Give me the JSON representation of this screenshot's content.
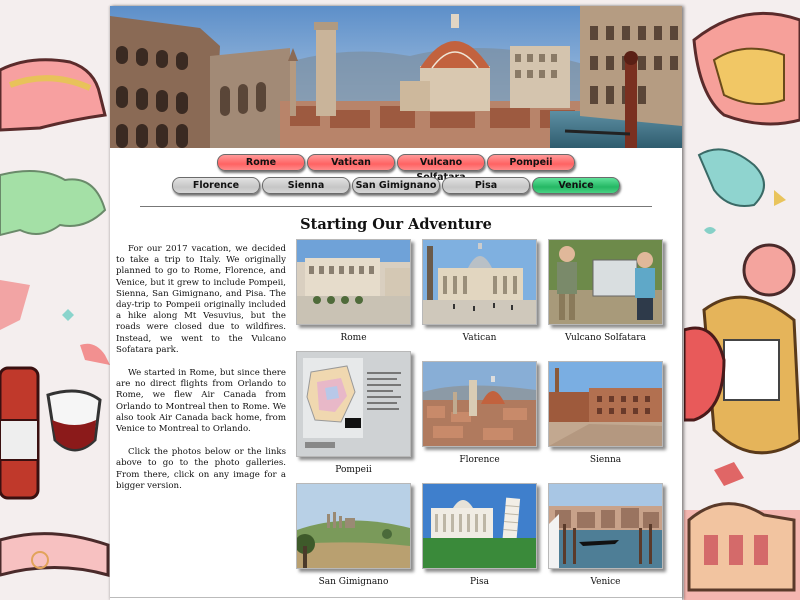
{
  "nav": {
    "row1": [
      {
        "label": "Rome",
        "color": "red"
      },
      {
        "label": "Vatican",
        "color": "red"
      },
      {
        "label": "Vulcano Solfatara",
        "color": "red"
      },
      {
        "label": "Pompeii",
        "color": "red"
      }
    ],
    "row2": [
      {
        "label": "Florence",
        "color": "gray"
      },
      {
        "label": "Sienna",
        "color": "gray"
      },
      {
        "label": "San Gimignano",
        "color": "gray"
      },
      {
        "label": "Pisa",
        "color": "gray"
      },
      {
        "label": "Venice",
        "color": "green"
      }
    ]
  },
  "main": {
    "title": "Starting Our Adventure",
    "paragraphs": [
      "For our 2017 vacation, we decided to take a trip to Italy. We originally planned to go to Rome, Florence, and Venice, but it grew to include Pompeii, Sienna, San Gimignano, and Pisa. The day-trip to Pompeii originally included a hike along Mt Vesuvius, but the roads were closed due to wildfires. Instead, we went to the Vulcano Sofatara park.",
      "We started in Rome, but since there are no direct flights from Orlando to Rome, we flew Air Canada from Orlando to Montreal then to Rome. We also took Air Canada back home, from Venice to Montreal to Orlando.",
      "Click the photos below or the links above to go to the photo galleries. From there, click on any image for a bigger version."
    ]
  },
  "gallery": [
    {
      "caption": "Rome"
    },
    {
      "caption": "Vatican"
    },
    {
      "caption": "Vulcano Solfatara"
    },
    {
      "caption": "Pompeii"
    },
    {
      "caption": "Florence"
    },
    {
      "caption": "Sienna"
    },
    {
      "caption": "San Gimignano"
    },
    {
      "caption": "Pisa"
    },
    {
      "caption": "Venice"
    }
  ],
  "colors": {
    "nav_red": "#ff6b6b",
    "nav_gray": "#cfcfcf",
    "nav_green": "#2fbf6d"
  }
}
